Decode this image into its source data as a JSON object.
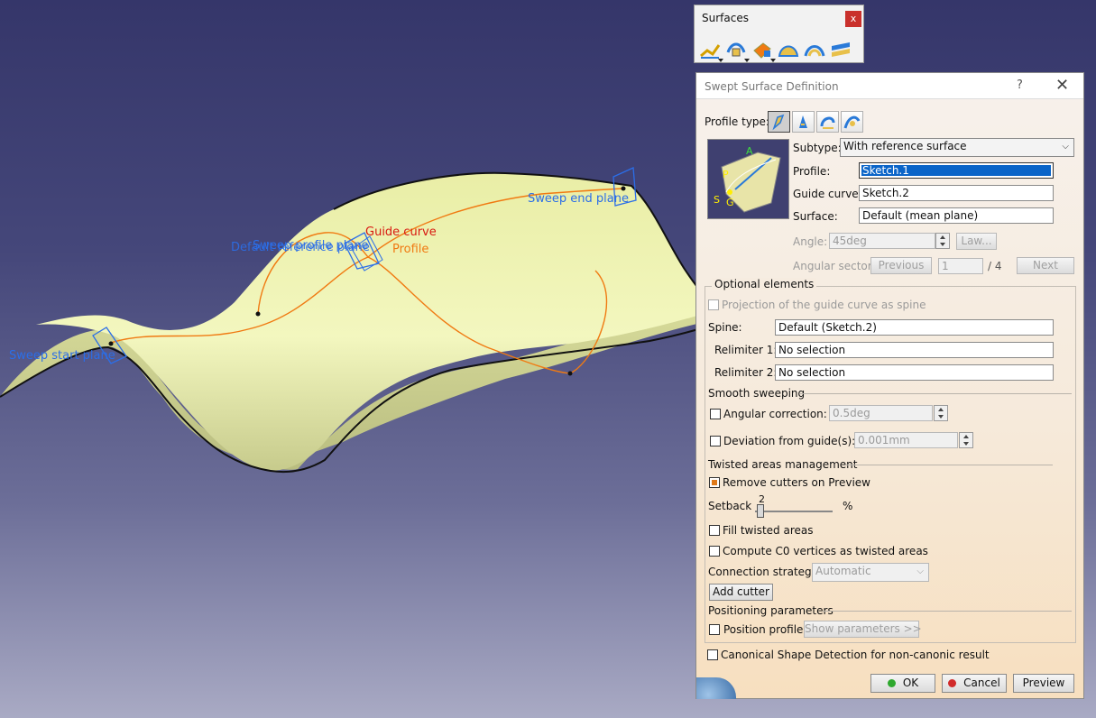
{
  "viewport": {
    "labels": {
      "sweep_start_plane": "Sweep start plane",
      "sweep_end_plane": "Sweep end plane",
      "guide_curve": "Guide curve",
      "profile": "Profile",
      "overlap_a": "Sweep profile plane",
      "overlap_b": "Default reference plane"
    },
    "colors": {
      "surface": "#eef3b0",
      "curve": "#f07a12",
      "plane_label": "#2b6ee8",
      "guide_label": "#d81a12"
    }
  },
  "toolbar": {
    "title": "Surfaces",
    "close": "x",
    "icons": [
      "sweep-icon",
      "extrude-icon",
      "offset-icon",
      "fill-icon",
      "blend-icon",
      "multi-section-icon"
    ]
  },
  "dialog": {
    "title": "Swept Surface Definition",
    "help": "?",
    "close": "✕",
    "profile_type_label": "Profile type:",
    "subtype_label": "Subtype:",
    "subtype_value": "With reference surface",
    "profile_label": "Profile:",
    "profile_value": "Sketch.1",
    "guide_label": "Guide curve:",
    "guide_value": "Sketch.2",
    "surface_label": "Surface:",
    "surface_value": "Default (mean plane)",
    "angle_label": "Angle:",
    "angle_value": "45deg",
    "law_button": "Law...",
    "angular_sector_label": "Angular sector:",
    "previous_button": "Previous",
    "sector_value": "1",
    "sector_total": "/ 4",
    "next_button": "Next",
    "optional_title": "Optional elements",
    "projection_label": "Projection of the guide curve as spine",
    "spine_label": "Spine:",
    "spine_value": "Default (Sketch.2)",
    "relimiter1_label": "Relimiter 1:",
    "relimiter1_value": "No selection",
    "relimiter2_label": "Relimiter 2:",
    "relimiter2_value": "No selection",
    "smooth_title": "Smooth sweeping",
    "angular_correction_label": "Angular correction:",
    "angular_correction_value": "0.5deg",
    "deviation_label": "Deviation from guide(s):",
    "deviation_value": "0.001mm",
    "twisted_title": "Twisted areas management",
    "remove_cutters_label": "Remove cutters on Preview",
    "setback_label": "Setback",
    "setback_value": "2",
    "setback_unit": "%",
    "setback_fraction": 0.02,
    "fill_twisted_label": "Fill twisted areas",
    "compute_c0_label": "Compute C0 vertices as twisted areas",
    "connection_label": "Connection strategy:",
    "connection_value": "Automatic",
    "add_cutter_button": "Add cutter",
    "positioning_title": "Positioning parameters",
    "position_profile_label": "Position profile",
    "show_params_button": "Show parameters >>",
    "canonical_label": "Canonical Shape Detection for non-canonic result",
    "ok_button": "OK",
    "cancel_button": "Cancel",
    "preview_button": "Preview",
    "preview_labels": {
      "a": "A",
      "p": "P",
      "s": "S",
      "g": "G"
    }
  }
}
